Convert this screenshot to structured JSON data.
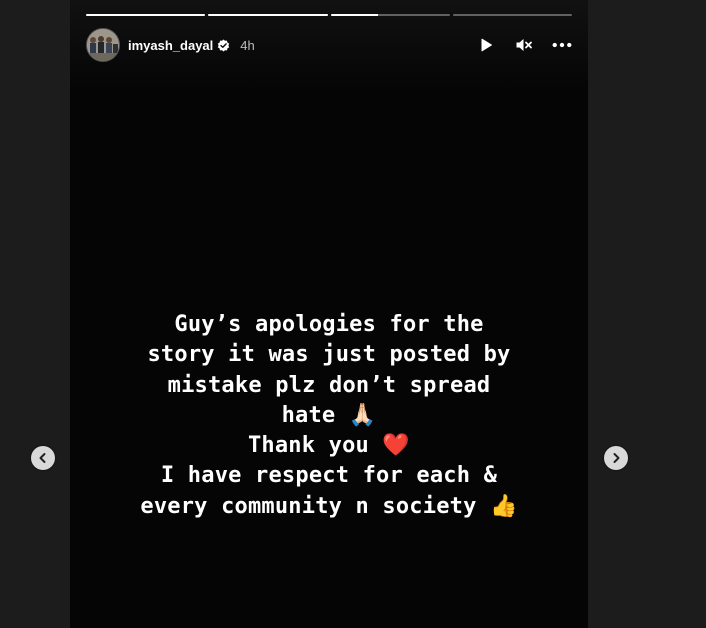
{
  "story": {
    "username": "imyash_dayal",
    "time_ago": "4h",
    "progress": [
      1.0,
      1.0,
      0.4,
      0.0
    ],
    "text_lines": [
      "Guy’s apologies for the",
      "story it was just posted by",
      "mistake plz don’t spread",
      "hate 🙏🏻",
      "Thank you ❤️",
      "I have respect for each &",
      "every community n society 👍"
    ]
  },
  "controls": {
    "play_icon": "play-icon",
    "mute_icon": "muted-speaker-icon",
    "more_icon": "more-options-icon"
  },
  "navigation": {
    "prev_icon": "chevron-left-icon",
    "next_icon": "chevron-right-icon"
  },
  "colors": {
    "background": "#1c1c1c",
    "story_background": "#050505",
    "text": "#ffffff",
    "nav_button": "#d9d9d9"
  }
}
